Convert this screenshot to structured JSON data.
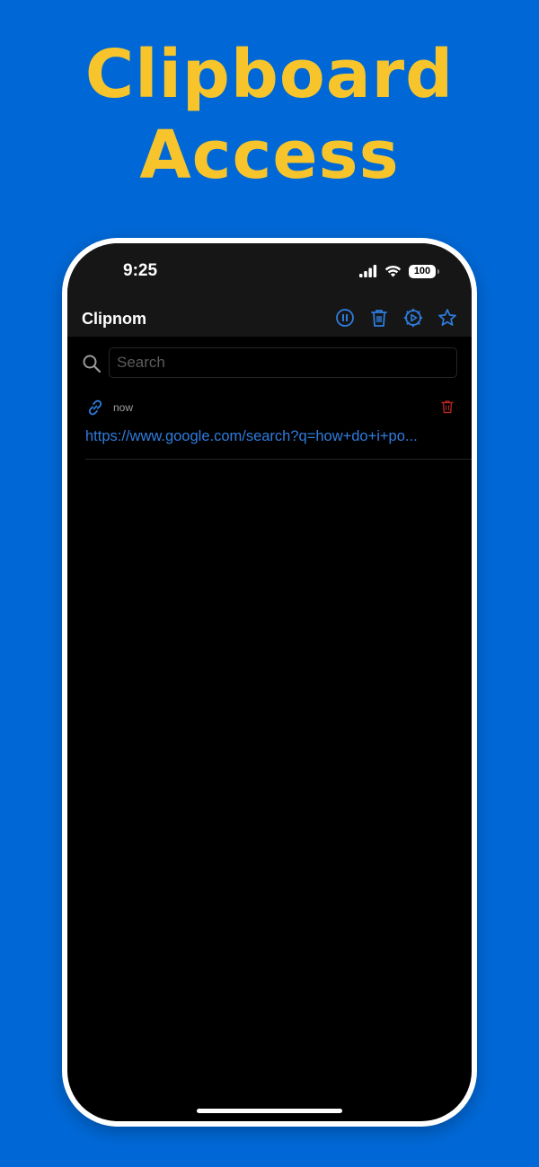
{
  "headline": {
    "line1": "Clipboard",
    "line2": "Access"
  },
  "status_bar": {
    "time": "9:25",
    "battery": "100"
  },
  "nav": {
    "title": "Clipnom",
    "actions": [
      "pause-icon",
      "trash-icon",
      "settings-play-icon",
      "star-icon"
    ]
  },
  "search": {
    "placeholder": "Search",
    "value": ""
  },
  "clips": [
    {
      "type_icon": "link-icon",
      "time": "now",
      "text": "https://www.google.com/search?q=how+do+i+po..."
    }
  ],
  "colors": {
    "background": "#0068d6",
    "headline": "#f7c52b",
    "accent": "#2e7dde",
    "delete": "#b3261e"
  }
}
